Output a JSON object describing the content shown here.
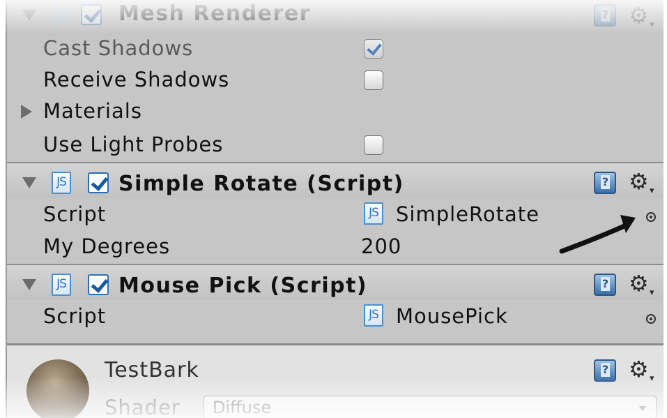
{
  "mesh_renderer": {
    "title": "Mesh Renderer",
    "properties": [
      {
        "label": "Cast Shadows",
        "checked": true
      },
      {
        "label": "Receive Shadows",
        "checked": false
      },
      {
        "label": "Materials"
      },
      {
        "label": "Use Light Probes",
        "checked": false
      }
    ]
  },
  "simple_rotate": {
    "icon_text": "JS",
    "title": "Simple Rotate  (Script)",
    "script_label": "Script",
    "script_value": "SimpleRotate",
    "degrees_label": "My Degrees",
    "degrees_value": "200"
  },
  "mouse_pick": {
    "icon_text": "JS",
    "title": "Mouse Pick (Script)",
    "script_label": "Script",
    "script_value": "MousePick"
  },
  "material": {
    "name": "TestBark",
    "shader_label": "Shader",
    "shader_value": "Diffuse"
  },
  "icons": {
    "help": "help-icon",
    "gear": "gear-icon",
    "picker": "object-picker-icon"
  },
  "colors": {
    "panel_bg": "#c6c6c6",
    "accent_blue": "#2a6fb5"
  }
}
